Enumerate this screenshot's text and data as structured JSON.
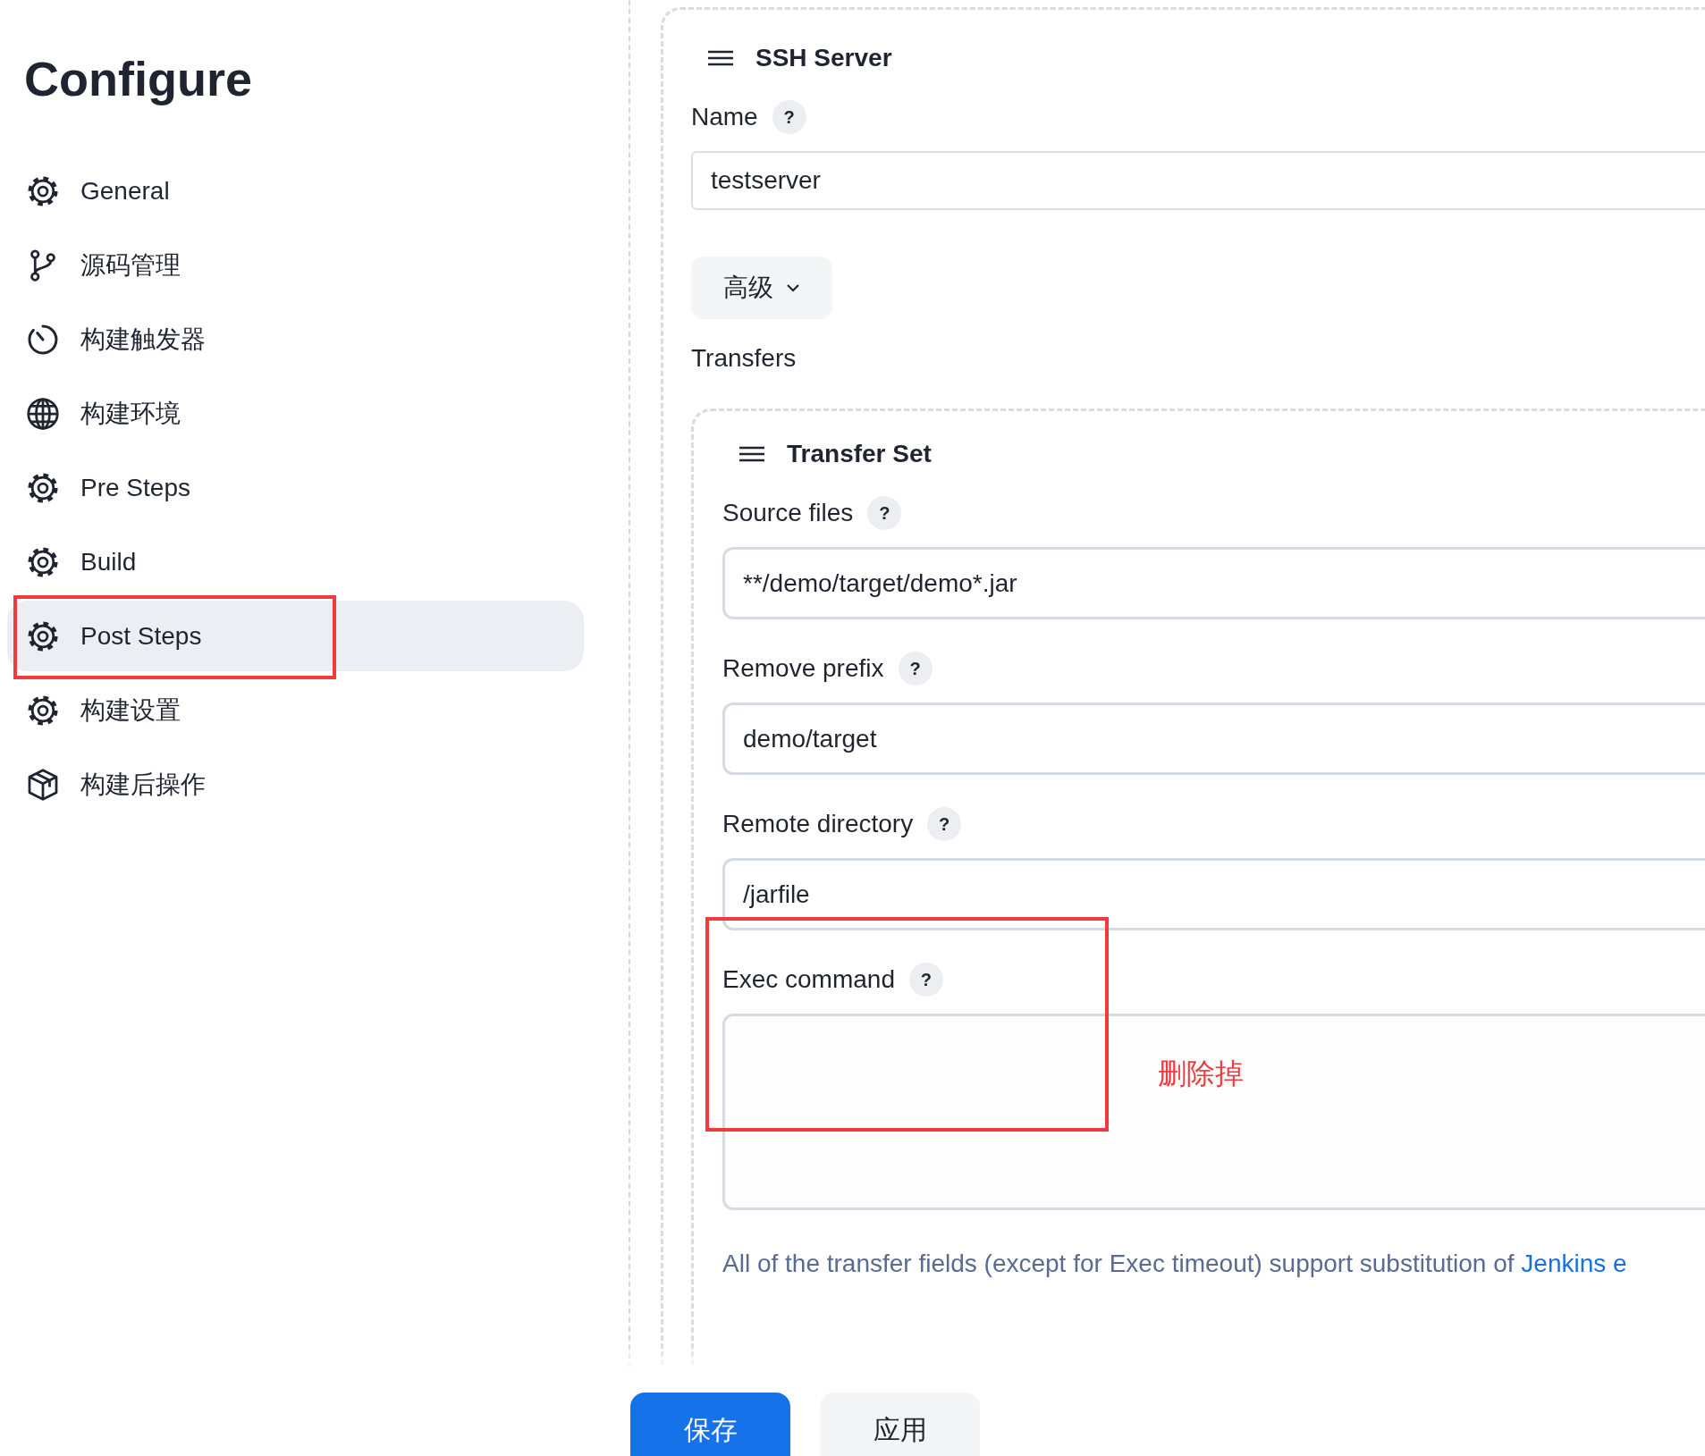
{
  "title": "Configure",
  "sidebar": {
    "items": [
      {
        "label": "General",
        "kind": "gear",
        "selected": false,
        "highlighted": false
      },
      {
        "label": "源码管理",
        "kind": "branch",
        "selected": false,
        "highlighted": false
      },
      {
        "label": "构建触发器",
        "kind": "clock",
        "selected": false,
        "highlighted": false
      },
      {
        "label": "构建环境",
        "kind": "globe",
        "selected": false,
        "highlighted": false
      },
      {
        "label": "Pre Steps",
        "kind": "gear",
        "selected": false,
        "highlighted": false
      },
      {
        "label": "Build",
        "kind": "gear",
        "selected": false,
        "highlighted": false
      },
      {
        "label": "Post Steps",
        "kind": "gear",
        "selected": true,
        "highlighted": true
      },
      {
        "label": "构建设置",
        "kind": "gear",
        "selected": false,
        "highlighted": false
      },
      {
        "label": "构建后操作",
        "kind": "box",
        "selected": false,
        "highlighted": false
      }
    ]
  },
  "ssh_server": {
    "title": "SSH Server",
    "name": {
      "label": "Name",
      "help": "?",
      "value": "testserver"
    },
    "advanced_button": "高级",
    "transfers_label": "Transfers",
    "transfer_set": {
      "title": "Transfer Set",
      "fields": [
        {
          "label": "Source files",
          "help": "?",
          "kind": "input",
          "value": "**/demo/target/demo*.jar",
          "highlighted": false
        },
        {
          "label": "Remove prefix",
          "help": "?",
          "kind": "input",
          "value": "demo/target",
          "highlighted": false
        },
        {
          "label": "Remote directory",
          "help": "?",
          "kind": "input",
          "value": "/jarfile",
          "highlighted": false
        },
        {
          "label": "Exec command",
          "help": "?",
          "kind": "textarea",
          "highlighted": true,
          "note": "删除掉"
        }
      ],
      "help_text": {
        "text": "All of the transfer fields (except for Exec timeout) support substitution of ",
        "link": "Jenkins e"
      }
    }
  },
  "buttons": [
    {
      "label": "保存",
      "kind": "primary"
    },
    {
      "label": "应用",
      "kind": "secondary"
    }
  ]
}
